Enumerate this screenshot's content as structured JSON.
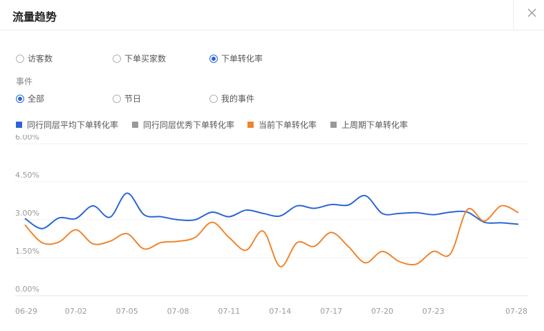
{
  "header": {
    "title": "流量趋势",
    "close_icon": "close-icon"
  },
  "metric_tabs": [
    {
      "label": "访客数",
      "checked": false
    },
    {
      "label": "下单买家数",
      "checked": false
    },
    {
      "label": "下单转化率",
      "checked": true
    }
  ],
  "event_filter": {
    "label": "事件",
    "options": [
      {
        "label": "全部",
        "checked": true
      },
      {
        "label": "节日",
        "checked": false
      },
      {
        "label": "我的事件",
        "checked": false
      }
    ]
  },
  "legend": [
    {
      "label": "同行同层平均下单转化率",
      "color": "#2a64d6"
    },
    {
      "label": "同行同层优秀下单转化率",
      "color": "#999999"
    },
    {
      "label": "当前下单转化率",
      "color": "#f0842c"
    },
    {
      "label": "上周期下单转化率",
      "color": "#999999"
    }
  ],
  "chart_data": {
    "type": "line",
    "y_tick_labels": [
      "0.00%",
      "1.50%",
      "3.00%",
      "4.50%",
      "6.00%"
    ],
    "ylim": [
      0,
      6
    ],
    "x_tick_labels": [
      "06-29",
      "07-02",
      "07-05",
      "07-08",
      "07-11",
      "07-14",
      "07-17",
      "07-20",
      "07-23",
      "07-28"
    ],
    "x_tick_index": [
      0,
      3,
      6,
      9,
      12,
      15,
      18,
      21,
      24,
      29
    ],
    "grid": true,
    "series": [
      {
        "name": "同行同层平均下单转化率",
        "color": "#2a64d6",
        "values": [
          3.05,
          2.65,
          3.07,
          3.05,
          3.55,
          3.1,
          4.05,
          3.2,
          3.12,
          3.0,
          3.0,
          3.3,
          3.12,
          3.38,
          3.25,
          3.15,
          3.55,
          3.45,
          3.6,
          3.58,
          3.95,
          3.25,
          3.25,
          3.28,
          3.2,
          3.3,
          3.3,
          2.9,
          2.88,
          2.82
        ]
      },
      {
        "name": "当前下单转化率",
        "color": "#f0842c",
        "values": [
          2.8,
          2.1,
          2.12,
          2.6,
          2.05,
          2.15,
          2.45,
          1.85,
          2.1,
          2.15,
          2.3,
          2.9,
          2.3,
          1.8,
          2.55,
          1.15,
          2.1,
          1.95,
          2.5,
          1.95,
          1.3,
          1.75,
          1.35,
          1.25,
          1.75,
          1.65,
          3.4,
          2.95,
          3.55,
          3.28
        ]
      }
    ]
  }
}
